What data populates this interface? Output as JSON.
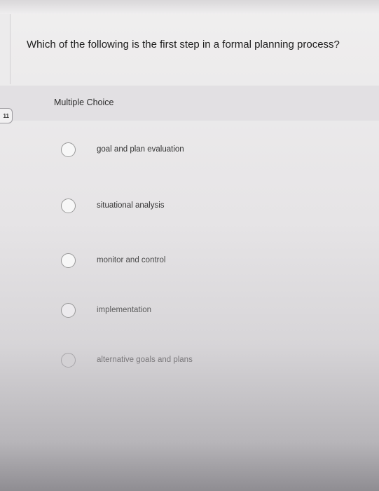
{
  "question": {
    "text": "Which of the following is the first step in a formal planning process?"
  },
  "section": {
    "label": "Multiple Choice"
  },
  "page_badge": "11",
  "options": [
    {
      "label": "goal and plan evaluation"
    },
    {
      "label": "situational analysis"
    },
    {
      "label": "monitor and control"
    },
    {
      "label": "implementation"
    },
    {
      "label": "alternative goals and plans"
    }
  ]
}
